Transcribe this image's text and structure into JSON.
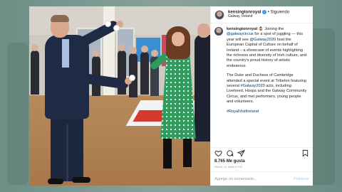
{
  "header": {
    "username": "kensingtonroyal",
    "separator": "•",
    "follow_label": "Siguiendo",
    "location": "Galway, Ireland"
  },
  "caption": {
    "username": "kensingtonroyal",
    "mention1_pre": "",
    "p1_a": " 🤹 Joining the ",
    "mention1": "@galwaycircus",
    "p1_b": " for a spot of juggling — this year will see ",
    "mention2": "@Galway2020",
    "p1_c": " host the European Capital of Culture on behalf of Ireland – a showcase of events highlighting the richness and diversity of Irish culture, and the country's proud history of artistic endeavour.",
    "p2_a": "The Duke and Duchess of Cambridge attended a special event at Tribeton featuring several ",
    "hashtag1": "#Galway2020",
    "p2_b": " acts, including Liveheed, Hoops and the Galway Community Circus, and met performers, young people and volunteers.",
    "hashtag2": "#RoyalVisitIreland"
  },
  "actions": {
    "like_icon": "heart-icon",
    "comment_icon": "comment-icon",
    "share_icon": "share-icon",
    "save_icon": "bookmark-icon"
  },
  "likes": {
    "count": "8.765",
    "label": "Me gusta"
  },
  "timestamp": "HACE 21 MINUTOS",
  "comment_box": {
    "placeholder": "Agrega un comentario...",
    "publish_label": "Publicar"
  },
  "colors": {
    "link": "#003569",
    "verified": "#3897f0",
    "publish_disabled": "#b2dffc"
  }
}
